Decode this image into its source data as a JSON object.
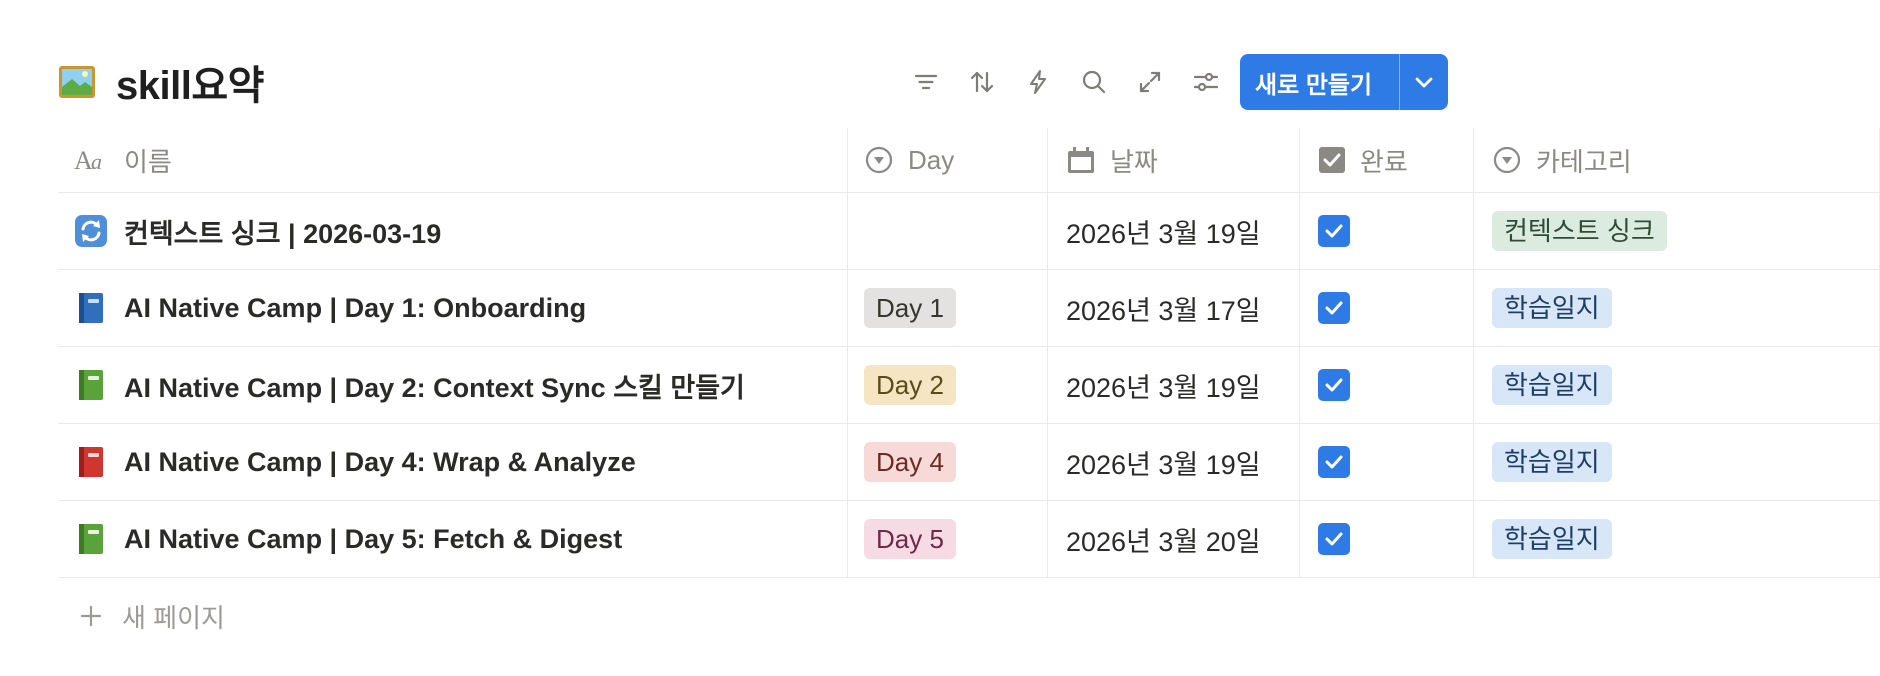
{
  "page": {
    "title": "skill요약",
    "title_icon": "framed-picture-icon"
  },
  "toolbar": {
    "icons": [
      "filter-icon",
      "sort-icon",
      "automation-bolt-icon",
      "search-icon",
      "expand-icon",
      "settings-sliders-icon"
    ],
    "new_button_label": "새로 만들기",
    "new_button_dropdown_icon": "chevron-down-icon"
  },
  "columns": [
    {
      "label": "이름",
      "icon": "text-property-icon"
    },
    {
      "label": "Day",
      "icon": "select-property-icon"
    },
    {
      "label": "날짜",
      "icon": "calendar-icon"
    },
    {
      "label": "완료",
      "icon": "checkbox-property-icon"
    },
    {
      "label": "카테고리",
      "icon": "select-property-icon"
    }
  ],
  "rows": [
    {
      "icon": "sync-arrows-icon",
      "name": "컨텍스트 싱크 | 2026-03-19",
      "day": "",
      "day_color": "",
      "date": "2026년 3월 19일",
      "done": true,
      "category": "컨텍스트 싱크",
      "category_color": "green"
    },
    {
      "icon": "blue-book-icon",
      "name": "AI Native Camp | Day 1: Onboarding",
      "day": "Day 1",
      "day_color": "gray",
      "date": "2026년 3월 17일",
      "done": true,
      "category": "학습일지",
      "category_color": "blue"
    },
    {
      "icon": "green-book-icon",
      "name": "AI Native Camp | Day 2: Context Sync 스킬 만들기",
      "day": "Day 2",
      "day_color": "yellow",
      "date": "2026년 3월 19일",
      "done": true,
      "category": "학습일지",
      "category_color": "blue"
    },
    {
      "icon": "red-book-icon",
      "name": "AI Native Camp | Day 4: Wrap & Analyze",
      "day": "Day 4",
      "day_color": "red",
      "date": "2026년 3월 19일",
      "done": true,
      "category": "학습일지",
      "category_color": "blue"
    },
    {
      "icon": "green-book-icon",
      "name": "AI Native Camp | Day 5: Fetch & Digest",
      "day": "Day 5",
      "day_color": "pink",
      "date": "2026년 3월 20일",
      "done": true,
      "category": "학습일지",
      "category_color": "blue"
    }
  ],
  "new_page_label": "새 페이지",
  "colors": {
    "accent": "#2f7be6",
    "pill_gray": "#e3e2e0",
    "pill_yellow": "#f5e5c2",
    "pill_red": "#f7d9d7",
    "pill_pink": "#f7dbe4",
    "pill_green": "#dcebdf",
    "pill_blue": "#d8e7f8"
  }
}
